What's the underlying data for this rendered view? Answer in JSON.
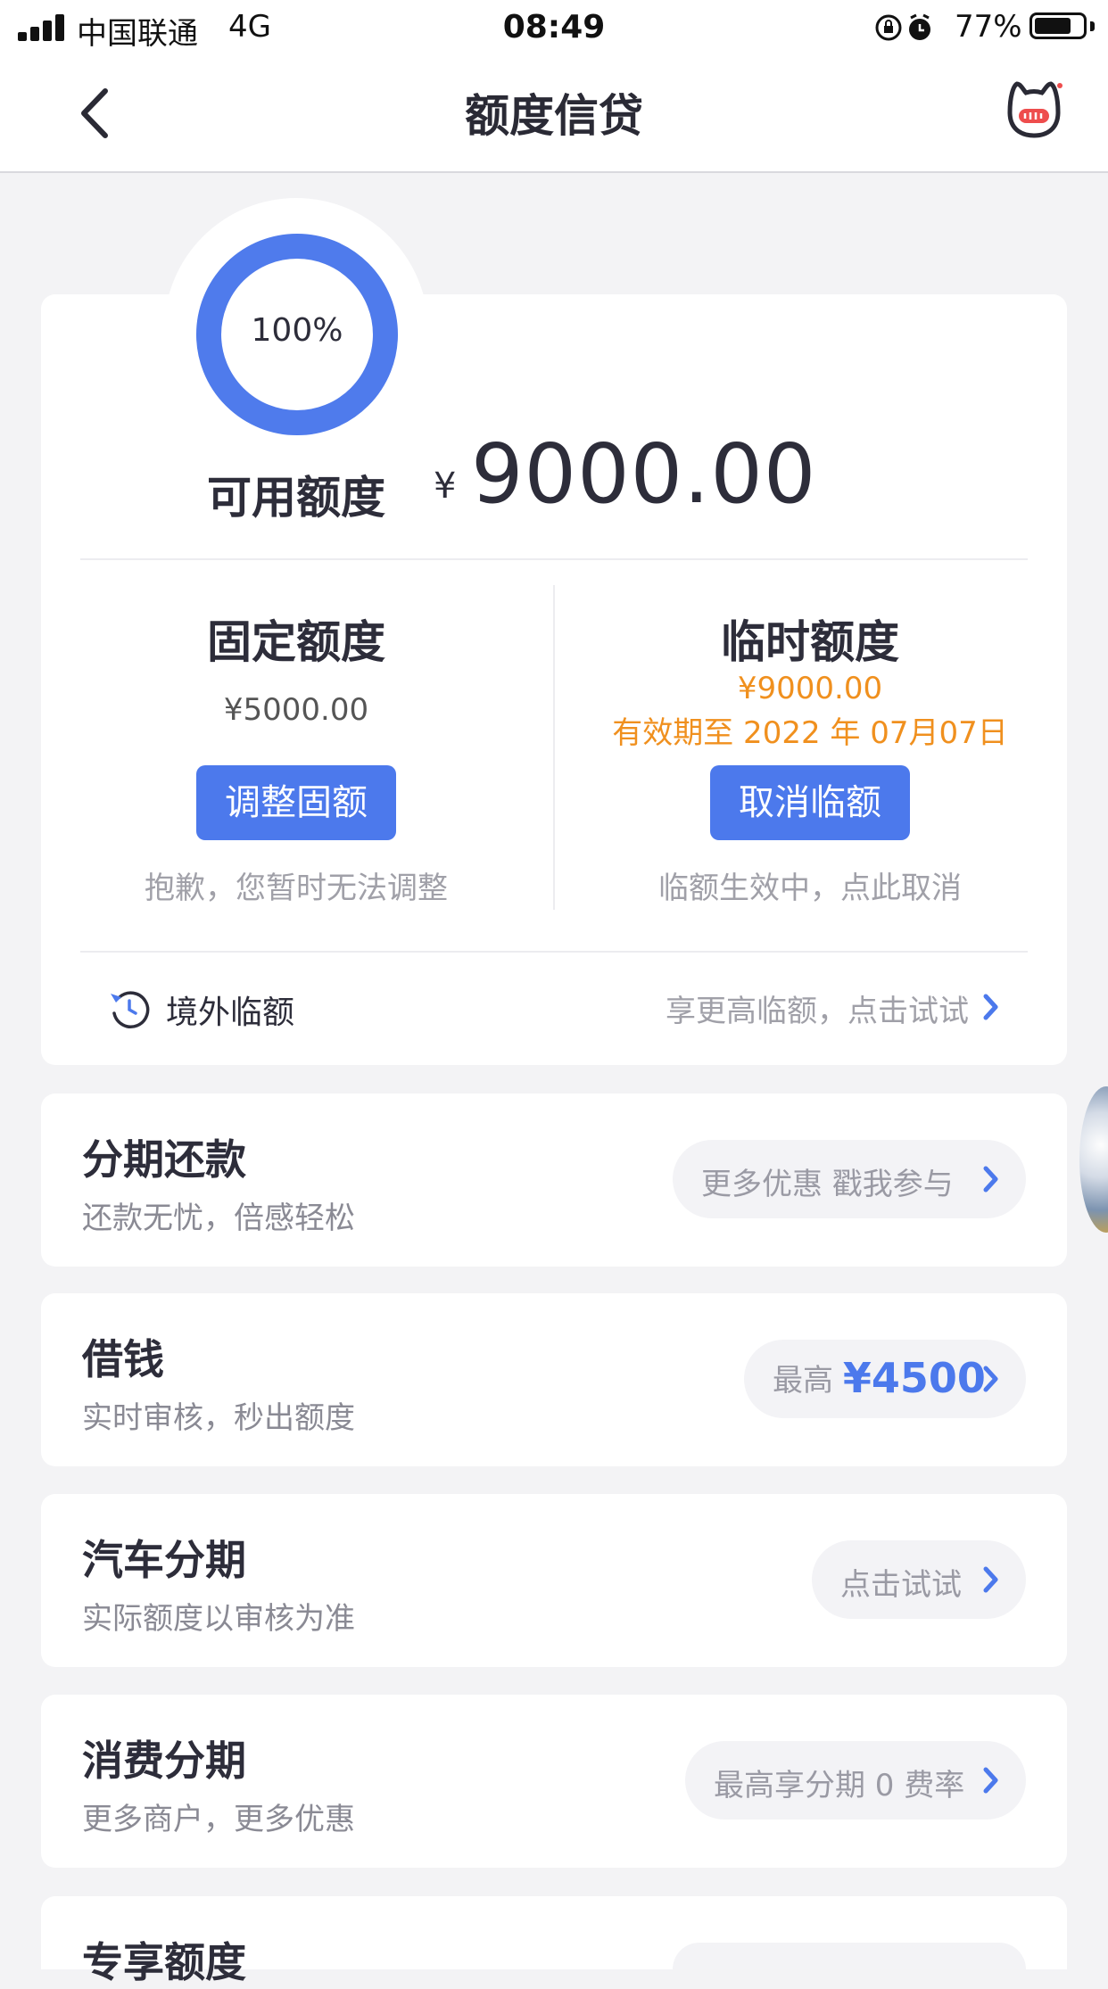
{
  "status_bar": {
    "carrier": "中国联通",
    "network": "4G",
    "time": "08:49",
    "battery_percent": "77%",
    "battery_level": 0.77
  },
  "nav": {
    "title": "额度信贷"
  },
  "quota": {
    "ring_percent_text": "100%",
    "ring_fraction": 1.0,
    "available_label": "可用额度",
    "currency": "¥",
    "available_amount": "9000.00",
    "fixed": {
      "title": "固定额度",
      "amount": "¥5000.00",
      "button": "调整固额",
      "note": "抱歉，您暂时无法调整"
    },
    "temporary": {
      "title": "临时额度",
      "amount": "¥9000.00",
      "valid_until": "有效期至 2022 年 07月07日",
      "button": "取消临额",
      "note": "临额生效中，点此取消"
    },
    "overseas": {
      "label": "境外临额",
      "hint": "享更高临额，点击试试"
    }
  },
  "cards": [
    {
      "title": "分期还款",
      "subtitle": "还款无忧，倍感轻松",
      "pill": "更多优惠 戳我参与"
    },
    {
      "title": "借钱",
      "subtitle": "实时审核，秒出额度",
      "pill_prefix": "最高",
      "pill_amount": "¥4500"
    },
    {
      "title": "汽车分期",
      "subtitle": "实际额度以审核为准",
      "pill": "点击试试"
    },
    {
      "title": "消费分期",
      "subtitle": "更多商户，更多优惠",
      "pill": "最高享分期 0 费率"
    },
    {
      "title": "专享额度"
    }
  ],
  "colors": {
    "accent": "#4c79ec",
    "orange": "#f0901e",
    "background": "#f3f3f5"
  }
}
